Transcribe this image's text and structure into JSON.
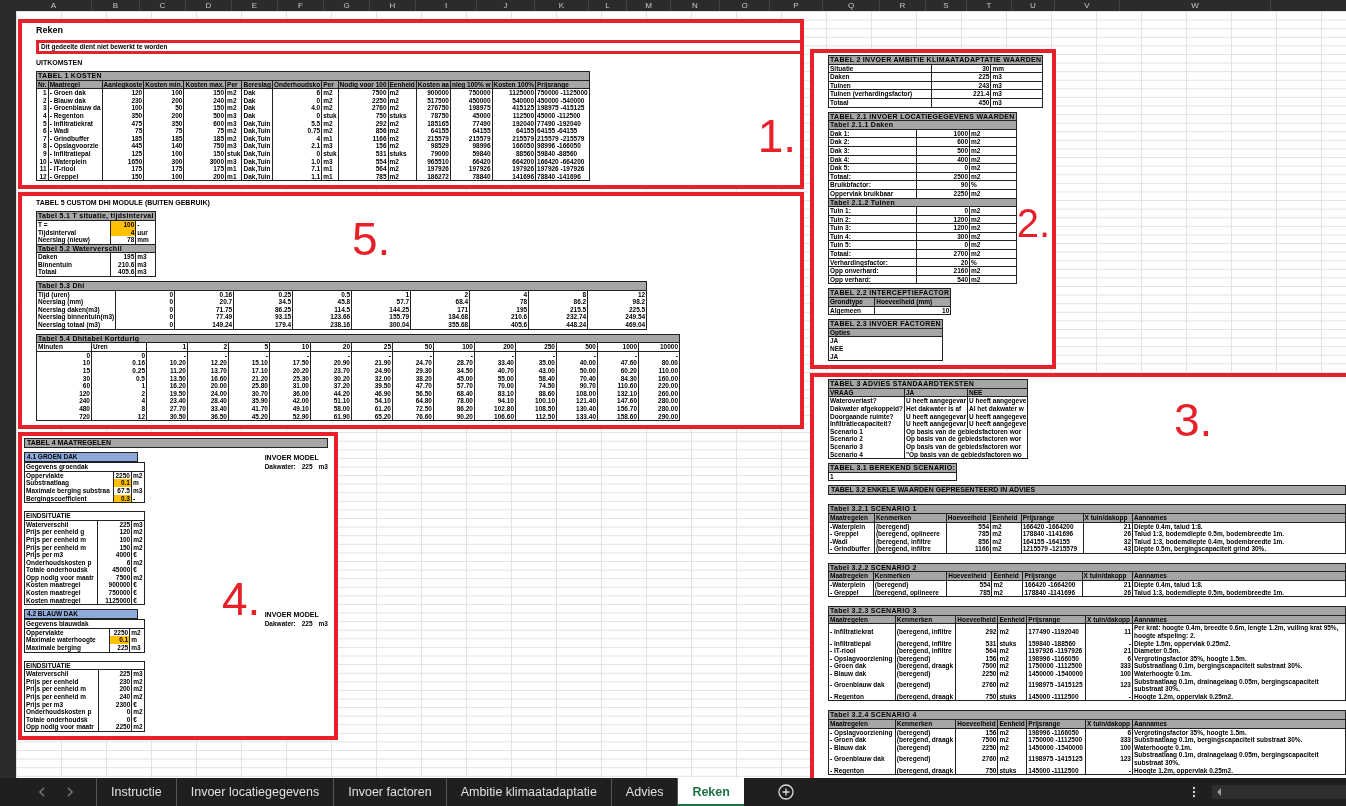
{
  "column_headers": [
    "A",
    "B",
    "C",
    "D",
    "E",
    "F",
    "G",
    "H",
    "I",
    "J",
    "K",
    "L",
    "M",
    "N",
    "O",
    "P",
    "Q",
    "R",
    "S",
    "T",
    "U",
    "V",
    "W"
  ],
  "table_1": {
    "marker": "1.",
    "sheet_title": "Reken",
    "notice": "Dit gedeelte dient niet bewerkt te worden",
    "section": "UITKOMSTEN",
    "title": "TABEL 1 KOSTEN",
    "columns": [
      "Nr.",
      "Maatregel",
      "Aanlegkoste",
      "Kosten min.",
      "Kosten max.",
      "Per",
      "Bereslag",
      "Onderhoudsko",
      "Per",
      "Nodig voor 100",
      "Eenheid",
      "Kosten aa",
      "nleg 100% w",
      "Kosten 100%",
      "Prijsrange"
    ],
    "rows": [
      [
        "1",
        "- Groen dak",
        "120",
        "100",
        "150",
        "m2",
        "Dak",
        "6",
        "m2",
        "7500",
        "m2",
        "900000",
        "750000",
        "1125000",
        "750000 -1125000"
      ],
      [
        "2",
        "- Blauw dak",
        "230",
        "200",
        "240",
        "m2",
        "Dak",
        "0",
        "m2",
        "2250",
        "m2",
        "517500",
        "450000",
        "540000",
        "450000 -540000"
      ],
      [
        "3",
        "- Groenblauw da",
        "100",
        "50",
        "150",
        "m2",
        "Dak",
        "4.0",
        "m2",
        "2760",
        "m2",
        "276750",
        "198975",
        "415125",
        "198975 -415125"
      ],
      [
        "4",
        "- Regenton",
        "350",
        "200",
        "500",
        "m3",
        "Dak",
        "0",
        "stuk",
        "750",
        "stuks",
        "78750",
        "45000",
        "112500",
        "45000 -112500"
      ],
      [
        "5",
        "- Infiltratiekrat",
        "475",
        "350",
        "600",
        "m3",
        "Dak,Tuin",
        "5.5",
        "m2",
        "292",
        "m2",
        "185165",
        "77490",
        "192040",
        "77490 -192040"
      ],
      [
        "6",
        "- Wadi",
        "75",
        "75",
        "75",
        "m2",
        "Dak,Tuin",
        "0.75",
        "m2",
        "856",
        "m2",
        "64155",
        "64155",
        "64155",
        "64155 -64155"
      ],
      [
        "7",
        "- Grindbuffer",
        "185",
        "185",
        "185",
        "m2",
        "Dak,Tuin",
        "4",
        "m1",
        "1166",
        "m2",
        "215579",
        "215579",
        "215579",
        "215579 -215579"
      ],
      [
        "8",
        "- Opslagvoorzie",
        "445",
        "140",
        "750",
        "m3",
        "Dak,Tuin",
        "2.1",
        "m3",
        "156",
        "m2",
        "98529",
        "98996",
        "166050",
        "98996 -166050"
      ],
      [
        "9",
        "- Infiltratiepal",
        "125",
        "100",
        "150",
        "stuk",
        "Dak,Tuin",
        "0",
        "stuk",
        "531",
        "stuks",
        "79000",
        "59840",
        "88560",
        "59840 -88560"
      ],
      [
        "10",
        "- Waterplein",
        "1650",
        "300",
        "3000",
        "m3",
        "Dak,Tuin",
        "1.0",
        "m3",
        "554",
        "m2",
        "965510",
        "66420",
        "664200",
        "166420 -664200"
      ],
      [
        "11",
        "- IT-riool",
        "175",
        "175",
        "175",
        "m1",
        "Dak,Tuin",
        "7.1",
        "m1",
        "564",
        "m2",
        "197926",
        "197926",
        "197926",
        "197926 -197926"
      ],
      [
        "12",
        "- Greppel",
        "150",
        "100",
        "200",
        "m1",
        "Dak,Tuin",
        "1.1",
        "m1",
        "785",
        "m2",
        "186272",
        "78840",
        "141696",
        "78840 -141696"
      ]
    ]
  },
  "table_2_group": {
    "marker": "2.",
    "ambition": {
      "title": "TABEL 2 INVOER AMBITIE KLIMAATADAPTATIE WAARDEN",
      "rows": [
        [
          "Situatie",
          "30",
          "mm"
        ],
        [
          "Daken",
          "225",
          "m3"
        ],
        [
          "Tuinen",
          "243",
          "m3"
        ],
        [
          "Tuinen (verhardingsfactor)",
          "221.4",
          "m3"
        ],
        [
          "Totaal",
          "450",
          "m3"
        ]
      ]
    },
    "location": {
      "title": "TABEL 2.1 INVOER LOCATIEGEGEVENS WAARDEN",
      "subtables": [
        {
          "title": "Tabel 2.1.1 Daken",
          "rows": [
            [
              "Dak 1:",
              "1000",
              "m2"
            ],
            [
              "Dak 2:",
              "600",
              "m2"
            ],
            [
              "Dak 3:",
              "500",
              "m2"
            ],
            [
              "Dak 4:",
              "400",
              "m2"
            ],
            [
              "Dak 5:",
              "0",
              "m2"
            ],
            [
              "Totaal:",
              "2500",
              "m2"
            ],
            [
              "Bruikbfactor:",
              "90",
              "%"
            ],
            [
              "Oppervlak bruikbaar",
              "2250",
              "m2"
            ]
          ]
        },
        {
          "title": "Tabel 2.1.2 Tuinen",
          "rows": [
            [
              "Tuin 1:",
              "0",
              "m2"
            ],
            [
              "Tuin 2:",
              "1200",
              "m2"
            ],
            [
              "Tuin 3:",
              "1200",
              "m2"
            ],
            [
              "Tuin 4:",
              "300",
              "m2"
            ],
            [
              "Tuin 5:",
              "0",
              "m2"
            ],
            [
              "Totaal:",
              "2700",
              "m2"
            ],
            [
              "Verhardingsfactor:",
              "20",
              "%"
            ],
            [
              "Opp onverhard:",
              "2160",
              "m2"
            ],
            [
              "Opp verhard:",
              "540",
              "m2"
            ]
          ]
        }
      ]
    },
    "interception": {
      "title": "TABEL 2.2 INTERCEPTIEFACTOR",
      "columns": [
        "Grondtype",
        "Hoeveelheid (mm)"
      ],
      "rows": [
        [
          "Algemeen",
          "10"
        ]
      ]
    },
    "factors": {
      "title": "TABEL 2.3 INVOER FACTOREN",
      "column": "Opties",
      "rows": [
        "JA",
        "NEE",
        "JA"
      ]
    }
  },
  "table_5": {
    "marker": "5.",
    "title": "TABEL 5 CUSTOM DHI MODULE (BUITEN GEBRUIK)",
    "parameters": {
      "title": "Tabel 5.1 T situatie, tijdsinterval",
      "rows": [
        {
          "label": "T =",
          "value": "100",
          "unit": "-",
          "input": true
        },
        {
          "label": "Tijdsinterval",
          "value": "4",
          "unit": "uur",
          "input": true
        },
        {
          "label": "Neerslag (nieuw)",
          "value": "78",
          "unit": "mm",
          "input": false
        }
      ]
    },
    "volumes": {
      "title": "Tabel 5.2 Waterverschil",
      "rows": [
        {
          "label": "Daken",
          "value": "195",
          "unit": "m3",
          "input": false
        },
        {
          "label": "Binnentuin",
          "value": "210.6",
          "unit": "m3",
          "input": false
        },
        {
          "label": "Totaal",
          "value": "405.6",
          "unit": "m3",
          "input": false
        }
      ]
    },
    "dhi": {
      "title": "Tabel 5.3 Dhi",
      "rows": [
        [
          "Tijd (uren)",
          "0",
          "0.16",
          "0.25",
          "0.5",
          "1",
          "2",
          "4",
          "8",
          "12"
        ],
        [
          "Neerslag (mm)",
          "0",
          "20.7",
          "34.5",
          "45.8",
          "57.7",
          "68.4",
          "78",
          "86.2",
          "98.2"
        ],
        [
          "Neerslag daken(m3)",
          "0",
          "71.75",
          "86.25",
          "114.5",
          "144.25",
          "171",
          "195",
          "215.5",
          "225.5"
        ],
        [
          "Neerslag binnentuin(m3)",
          "0",
          "77.49",
          "93.15",
          "123.66",
          "155.79",
          "184.68",
          "210.6",
          "232.74",
          "249.54"
        ],
        [
          "Neerslag totaal (m3)",
          "0",
          "149.24",
          "179.4",
          "238.16",
          "300.04",
          "355.68",
          "405.6",
          "448.24",
          "469.04"
        ]
      ]
    },
    "dhi_table": {
      "title": "Tabel 5.4 Dhitabel Kortdurig",
      "columns": [
        "Minuten",
        "Uren",
        "1",
        "2",
        "5",
        "10",
        "20",
        "25",
        "50",
        "100",
        "200",
        "250",
        "500",
        "1000",
        "10000"
      ],
      "rows": [
        [
          "0",
          "0",
          "-",
          "-",
          "-",
          "-",
          "-",
          "-",
          "-",
          "-",
          "-",
          "-",
          "-",
          "-",
          "-"
        ],
        [
          "10",
          "0.16",
          "10.20",
          "12.20",
          "15.10",
          "17.50",
          "20.90",
          "21.90",
          "24.70",
          "28.70",
          "33.40",
          "35.00",
          "40.00",
          "47.60",
          "80.00"
        ],
        [
          "15",
          "0.25",
          "11.20",
          "13.70",
          "17.10",
          "20.20",
          "23.70",
          "24.90",
          "29.30",
          "34.50",
          "40.70",
          "43.00",
          "50.00",
          "60.20",
          "110.00"
        ],
        [
          "30",
          "0.5",
          "13.50",
          "16.60",
          "21.20",
          "25.30",
          "30.20",
          "32.00",
          "38.20",
          "45.00",
          "55.00",
          "58.40",
          "70.40",
          "84.30",
          "160.00"
        ],
        [
          "60",
          "1",
          "16.20",
          "20.00",
          "25.80",
          "31.00",
          "37.20",
          "39.50",
          "47.70",
          "57.70",
          "70.00",
          "74.50",
          "90.70",
          "110.60",
          "220.00"
        ],
        [
          "120",
          "2",
          "19.50",
          "24.00",
          "30.70",
          "36.00",
          "44.20",
          "46.90",
          "56.50",
          "68.40",
          "83.10",
          "88.60",
          "108.00",
          "132.10",
          "260.00"
        ],
        [
          "240",
          "4",
          "23.40",
          "28.40",
          "35.90",
          "42.00",
          "51.10",
          "54.10",
          "64.80",
          "78.00",
          "94.10",
          "100.10",
          "121.40",
          "147.60",
          "280.00"
        ],
        [
          "480",
          "8",
          "27.70",
          "33.40",
          "41.70",
          "49.10",
          "58.00",
          "61.20",
          "72.50",
          "86.20",
          "102.80",
          "108.50",
          "130.40",
          "156.70",
          "280.00"
        ],
        [
          "720",
          "12",
          "30.50",
          "36.50",
          "45.20",
          "52.90",
          "61.90",
          "65.20",
          "76.60",
          "90.20",
          "106.60",
          "112.50",
          "133.40",
          "158.60",
          "290.00"
        ]
      ]
    }
  },
  "table_3_group": {
    "marker": "3.",
    "texts": {
      "title": "TABEL 3 ADVIES STANDAARDTEKSTEN",
      "columns": [
        "VRAAG",
        "JA",
        "NEE"
      ],
      "rows": [
        {
          "question": "Wateroverlast?",
          "yes": "U heeft aangegevar",
          "no": "U heeft aangegeve"
        },
        {
          "question": "Dakwater afgekoppeld?",
          "yes": "Het dakwater is af",
          "no": "Al het dakwater w"
        },
        {
          "question": "Doorgaande ruimte?",
          "yes": "U heeft aangegevar",
          "no": "U heeft aangegeve"
        },
        {
          "question": "Infiltratiecapaciteit?",
          "yes": "U heeft aangegevar",
          "no": "U heeft aangegeve"
        },
        {
          "question": "Scenario 1",
          "yes": "Op basis van de gebiedsfactoren wor"
        },
        {
          "question": "Scenario 2",
          "yes": "Op basis van de gebiedsfactoren wor"
        },
        {
          "question": "Scenario 3",
          "yes": "Op basis van de gebiedsfactoren wor"
        },
        {
          "question": "Scenario 4",
          "yes": "\"Op basis van de gebiedsfactoren wo"
        }
      ]
    },
    "scenario": {
      "title": "TABEL 3.1 BEREKEND SCENARIO:",
      "value": "1"
    },
    "values": {
      "title": "TABEL 3.2 ENKELE WAARDEN GEPRESENTEERD IN ADVIES",
      "scenarios": [
        {
          "title": "Tabel 3.2.1 SCENARIO 1",
          "columns": [
            "Maatregelen",
            "Kenmerken",
            "Hoeveelheid",
            "Eenheid",
            "Prijsrange",
            "X tuin/dakopp",
            "Aannames"
          ],
          "rows": [
            [
              "-Waterplein",
              "(beregend)",
              "554",
              "m2",
              "166420 -1664200",
              "21",
              "Diepte 0.4m, talud 1:8."
            ],
            [
              "- Greppel",
              "(beregend, oplineere",
              "785",
              "m2",
              "178840 -1141696",
              "26",
              "Talud 1:3, bodemdiepte 0.5m, bodembreedte 1m."
            ],
            [
              "-Wadi",
              "(beregend, infiltre",
              "856",
              "m2",
              "164155 -164155",
              "32",
              "Talud 1:3, bodemdiepte 0.4m, bodembreedte 1m."
            ],
            [
              "- Grindbuffer",
              "(beregend, infiltre",
              "1166",
              "m2",
              "1215579 -1215579",
              "43",
              "Diepte 0.5m, bergingscapaciteit grind 30%."
            ]
          ]
        },
        {
          "title": "Tabel 3.2.2 SCENARIO 2",
          "columns": [
            "Maatregelen",
            "Kenmerken",
            "Hoeveelheid",
            "Eenheid",
            "Prijsrange",
            "X tuin/dakopp",
            "Aannames"
          ],
          "rows": [
            [
              "-Waterplein",
              "(beregend)",
              "554",
              "m2",
              "166420 -1664200",
              "21",
              "Diepte 0.4m, talud 1:8."
            ],
            [
              "- Greppel",
              "(beregend, oplineere",
              "785",
              "m2",
              "178840 -1141696",
              "26",
              "Talud 1:3, bodemdiepte 0.5m, bodembreedte 1m."
            ]
          ]
        },
        {
          "title": "Tabel 3.2.3 SCENARIO 3",
          "columns": [
            "Maatregelen",
            "Kenmerken",
            "Hoeveelheid",
            "Eenheid",
            "Prijsrange",
            "X tuin/dakopp",
            "Aannames"
          ],
          "rows": [
            [
              "- Infiltratiekrat",
              "(beregend, infiltre",
              "292",
              "m2",
              "177490 -1192040",
              "11",
              "Per krat: hoogte 0.4m, breedte 0.6m, lengte 1.2m, vulling krat 95%, hoogte afspeling: 2."
            ],
            [
              "- Infiltratiepal",
              "(beregend, infiltre",
              "531",
              "stuks",
              "159840 -188560",
              "-",
              "Diepte 1.5m, oppervlak 0.25m2."
            ],
            [
              "- IT-riool",
              "(beregend, infiltre",
              "564",
              "m2",
              "1197926 -1197926",
              "21",
              "Diameter 0.5m."
            ],
            [
              "- Opslagvoorziening",
              "(beregend)",
              "156",
              "m2",
              "198996 -1166050",
              "6",
              "Vergrotingsfactor 35%, hoogte 1.5m."
            ],
            [
              "- Groen dak",
              "(beregend, draagk",
              "7500",
              "m2",
              "1750000 -1112500",
              "333",
              "Substraatlaag 0.1m, bergingscapaciteit substraat 30%."
            ],
            [
              "- Blauw dak",
              "(beregend)",
              "2250",
              "m2",
              "1450000 -1540000",
              "100",
              "Waterhoogte 0.1m."
            ],
            [
              "- Groenblauw dak",
              "(beregend)",
              "2760",
              "m2",
              "1198975 -1415125",
              "123",
              "Substraatlaag 0.1m, drainagelaag 0.05m, bergingscapaciteit substraat 30%."
            ],
            [
              "- Regenton",
              "(beregend, draagk",
              "750",
              "stuks",
              "145000 -1112500",
              "-",
              "Hoogte 1.2m, oppervlak 0.25m2."
            ]
          ]
        },
        {
          "title": "Tabel 3.2.4 SCENARIO 4",
          "columns": [
            "Maatregelen",
            "Kenmerken",
            "Hoeveelheid",
            "Eenheid",
            "Prijsrange",
            "X tuin/dakopp",
            "Aannames"
          ],
          "rows": [
            [
              "- Opslagvoorziening",
              "(beregend)",
              "156",
              "m2",
              "198996 -1166050",
              "6",
              "Vergrotingsfactor 35%, hoogte 1.5m."
            ],
            [
              "- Groen dak",
              "(beregend, draagk",
              "7500",
              "m2",
              "1750000 -1112500",
              "333",
              "Substraatlaag 0.1m, bergingscapaciteit substraat 30%."
            ],
            [
              "- Blauw dak",
              "(beregend)",
              "2250",
              "m2",
              "1450000 -1540000",
              "100",
              "Waterhoogte 0.1m."
            ],
            [
              "- Groenblauw dak",
              "(beregend)",
              "2760",
              "m2",
              "1198975 -1415125",
              "123",
              "Substraatlaag 0.1m, drainagelaag 0.05m, bergingscapaciteit substraat 30%."
            ],
            [
              "- Regenton",
              "(beregend, draagk",
              "750",
              "stuks",
              "145000 -1112500",
              "-",
              "Hoogte 1.2m, oppervlak 0.25m2."
            ]
          ]
        }
      ]
    }
  },
  "table_4": {
    "marker": "4.",
    "title": "TABEL 4 MAATREGELEN",
    "sections": [
      {
        "title": "4.1 GROEN DAK",
        "data_title": "Gegevens groendak",
        "inputs": [
          {
            "label": "Oppervlakte",
            "value": "2250",
            "unit": "m2",
            "input": false
          },
          {
            "label": "Substraatlaag",
            "value": "0.1",
            "unit": "m",
            "input": true
          },
          {
            "label": "Maximale berging substraa",
            "value": "67.5",
            "unit": "m3",
            "input": false
          },
          {
            "label": "Bergingscoefficient",
            "value": "0.3",
            "unit": "-",
            "input": true
          }
        ],
        "model_title": "INVOER MODEL",
        "model": {
          "label": "Dakwater:",
          "value": "225",
          "unit": "m3"
        },
        "result_title": "EINDSITUATIE",
        "results": [
          [
            "Waterverschil",
            "225",
            "m3"
          ],
          [
            "Prijs per eenheid g",
            "120",
            "m2"
          ],
          [
            "Prijs per eenheid m",
            "100",
            "m2"
          ],
          [
            "Prijs per eenheid m",
            "150",
            "m2"
          ],
          [
            "Prijs per m3",
            "4000",
            "€"
          ],
          [
            "Onderhoudskosten p",
            "6",
            "m2"
          ],
          [
            "Totale onderhoudsk",
            "45000",
            "€"
          ],
          [
            "Opp nodig voor maatr",
            "7500",
            "m2"
          ],
          [
            "Kosten maatregel",
            "900000",
            "€"
          ],
          [
            "Kosten maatregel",
            "750000",
            "€"
          ],
          [
            "Kosten maatregel",
            "1125000",
            "€"
          ]
        ]
      },
      {
        "title": "4.2 BLAUW DAK",
        "data_title": "Gegevens blauwdak",
        "inputs": [
          {
            "label": "Oppervlakte",
            "value": "2250",
            "unit": "m2",
            "input": false
          },
          {
            "label": "Maximale waterhoogte",
            "value": "0.1",
            "unit": "m",
            "input": true
          },
          {
            "label": "Maximale berging",
            "value": "225",
            "unit": "m3",
            "input": false
          }
        ],
        "model_title": "INVOER MODEL",
        "model": {
          "label": "Dakwater:",
          "value": "225",
          "unit": "m3"
        },
        "result_title": "EINDSITUATIE",
        "results": [
          [
            "Waterverschil",
            "225",
            "m3"
          ],
          [
            "Prijs per eenheid",
            "230",
            "m2"
          ],
          [
            "Prijs per eenheid m",
            "200",
            "m2"
          ],
          [
            "Prijs per eenheid m",
            "240",
            "m2"
          ],
          [
            "Prijs per m3",
            "2300",
            "€"
          ],
          [
            "Onderhoudskosten p",
            "0",
            "m2"
          ],
          [
            "Totale onderhoudsk",
            "0",
            "€"
          ],
          [
            "Opp nodig voor maatr",
            "2250",
            "m2"
          ]
        ]
      }
    ]
  },
  "sheet_tabs": [
    {
      "label": "Instructie",
      "selected": false
    },
    {
      "label": "Invoer locatiegegevens",
      "selected": false
    },
    {
      "label": "Invoer factoren",
      "selected": false
    },
    {
      "label": "Ambitie klimaatadaptatie",
      "selected": false
    },
    {
      "label": "Advies",
      "selected": false
    },
    {
      "label": "Reken",
      "selected": true
    }
  ]
}
